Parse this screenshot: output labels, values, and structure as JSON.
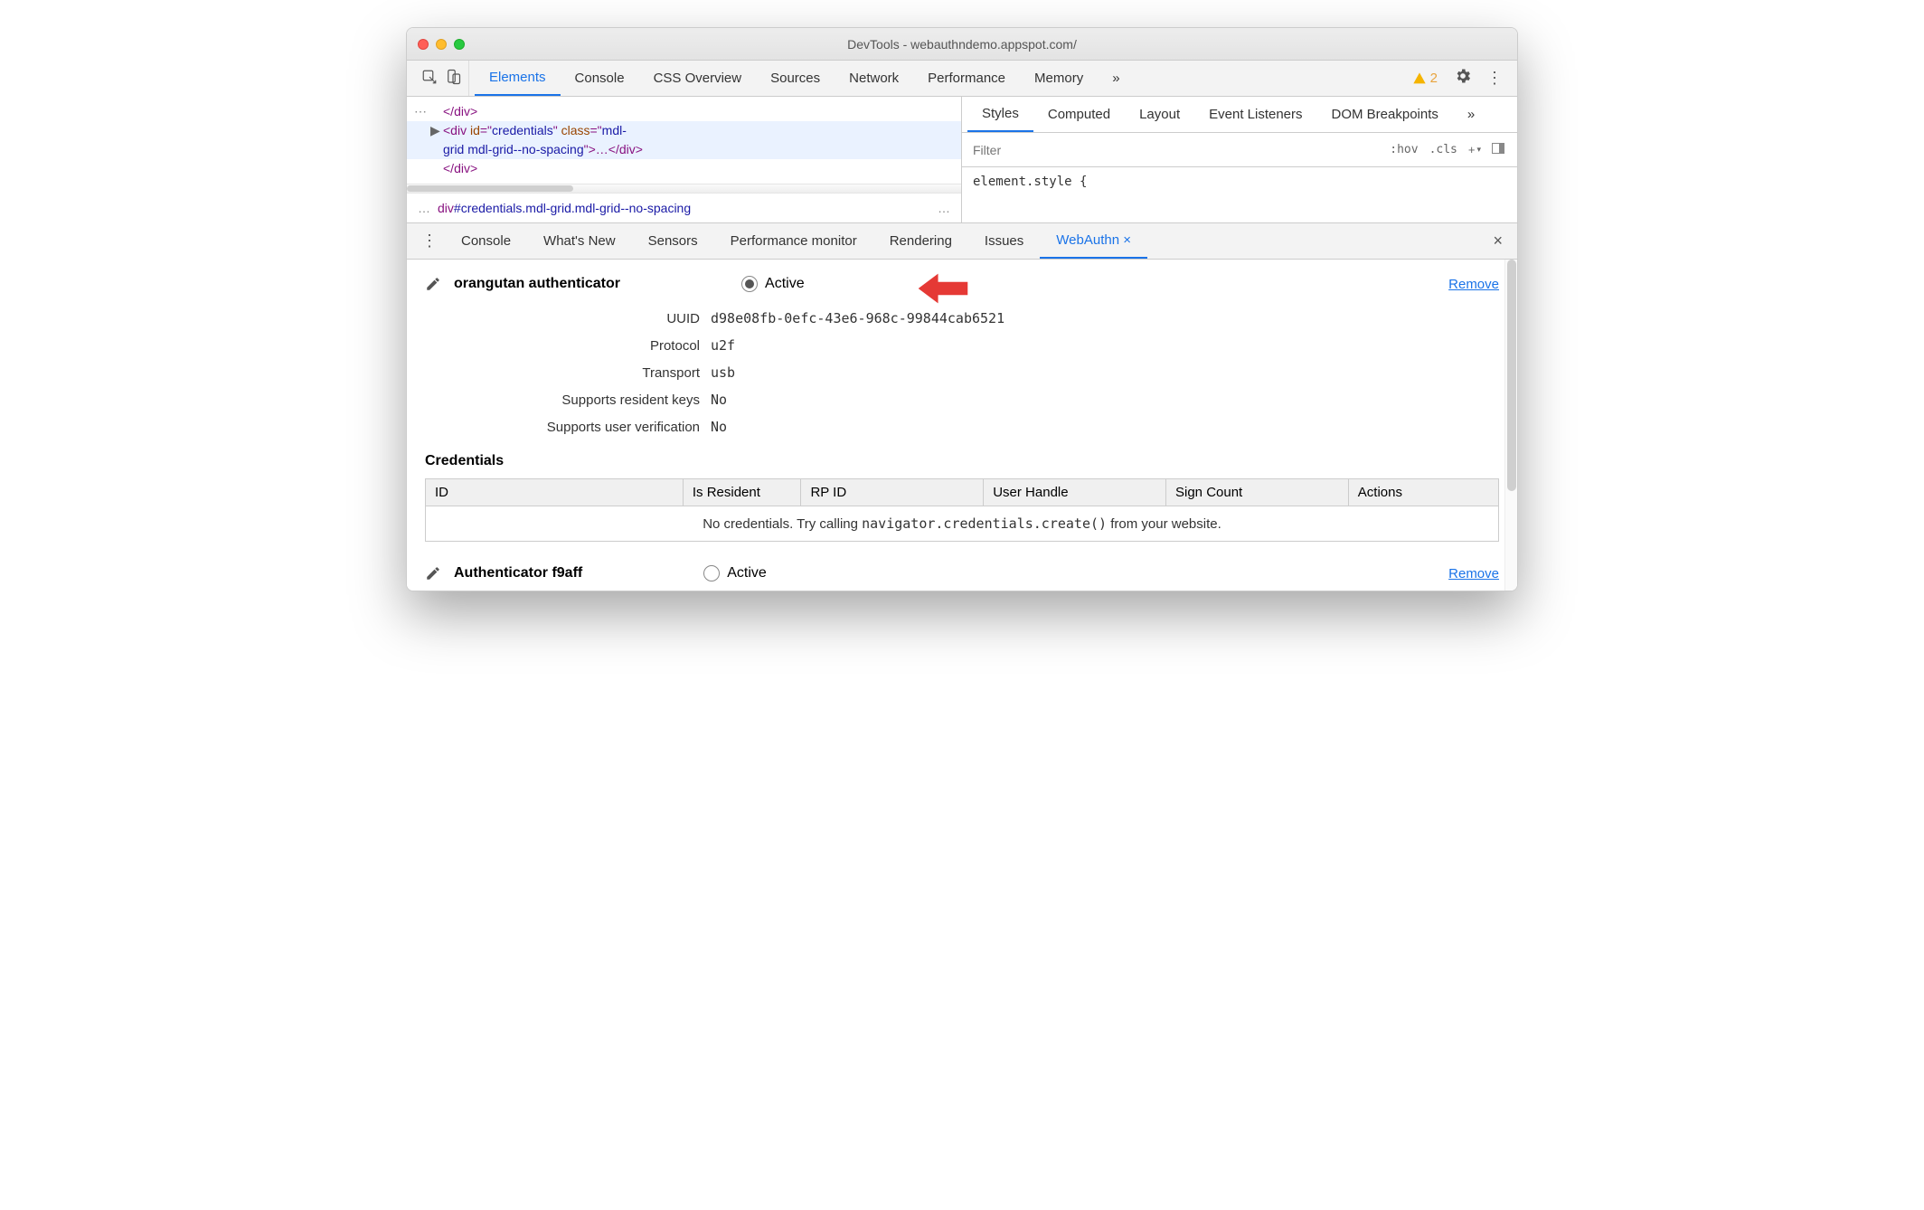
{
  "window": {
    "title": "DevTools - webauthndemo.appspot.com/"
  },
  "main_tabs": {
    "elements": "Elements",
    "console": "Console",
    "css_overview": "CSS Overview",
    "sources": "Sources",
    "network": "Network",
    "performance": "Performance",
    "memory": "Memory",
    "more": "»",
    "warnings_count": "2"
  },
  "dom": {
    "line1": "</div>",
    "tag_open": "<div ",
    "attr_id_name": "id",
    "attr_id_val": "credentials",
    "attr_class_name": "class",
    "attr_class_val_a": "mdl-",
    "attr_class_val_b": "grid mdl-grid--no-spacing",
    "close": ">…</div>",
    "line3": "</div>",
    "breadcrumb_el": "div",
    "breadcrumb_id": "#credentials",
    "breadcrumb_cls": ".mdl-grid.mdl-grid--no-spacing"
  },
  "style_tabs": {
    "styles": "Styles",
    "computed": "Computed",
    "layout": "Layout",
    "event_listeners": "Event Listeners",
    "dom_breakpoints": "DOM Breakpoints",
    "more": "»"
  },
  "filter": {
    "placeholder": "Filter",
    "hov": ":hov",
    "cls": ".cls",
    "plus": "+"
  },
  "element_style": "element.style {",
  "drawer_tabs": {
    "console": "Console",
    "whats_new": "What's New",
    "sensors": "Sensors",
    "perf_monitor": "Performance monitor",
    "rendering": "Rendering",
    "issues": "Issues",
    "webauthn": "WebAuthn"
  },
  "auth1": {
    "name": "orangutan authenticator",
    "active": "Active",
    "remove": "Remove",
    "rows": {
      "uuid_lbl": "UUID",
      "uuid_val": "d98e08fb-0efc-43e6-968c-99844cab6521",
      "protocol_lbl": "Protocol",
      "protocol_val": "u2f",
      "transport_lbl": "Transport",
      "transport_val": "usb",
      "resident_lbl": "Supports resident keys",
      "resident_val": "No",
      "userver_lbl": "Supports user verification",
      "userver_val": "No"
    }
  },
  "credentials": {
    "heading": "Credentials",
    "cols": {
      "id": "ID",
      "resident": "Is Resident",
      "rpid": "RP ID",
      "user_handle": "User Handle",
      "sign_count": "Sign Count",
      "actions": "Actions"
    },
    "empty_pre": "No credentials. Try calling ",
    "empty_code": "navigator.credentials.create()",
    "empty_post": " from your website."
  },
  "auth2": {
    "name": "Authenticator f9aff",
    "active": "Active",
    "remove": "Remove"
  }
}
